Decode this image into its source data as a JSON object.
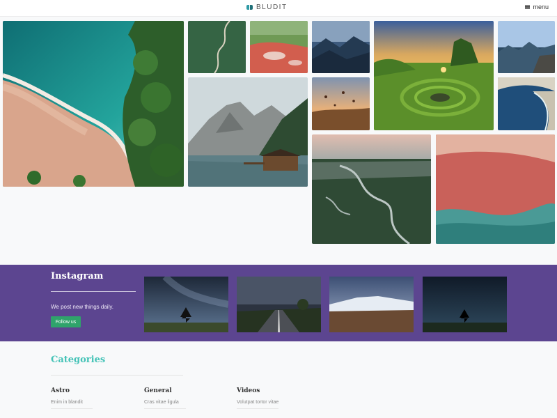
{
  "header": {
    "brand": "BLUDIT",
    "brand_icon": "bludit-logo-icon",
    "menu_label": "menu",
    "menu_icon": "hamburger-icon"
  },
  "gallery": {
    "photos": [
      "beach-aerial-photo",
      "winding-road-photo",
      "red-lake-photo",
      "misty-mountains-photo",
      "green-hill-sunset-photo",
      "mountain-cliff-photo",
      "hot-air-balloons-photo",
      "bay-aerial-photo",
      "lake-cabin-photo",
      "river-valley-photo",
      "pink-lagoon-aerial-photo"
    ]
  },
  "instagram": {
    "title": "Instagram",
    "description": "We post new things daily.",
    "button_label": "Follow us",
    "background_color": "#5c4590",
    "button_color": "#2fa36b",
    "photos": [
      "milky-way-tree-photo",
      "night-road-photo",
      "snowy-mountain-dusk-photo",
      "starry-night-tree-photo"
    ]
  },
  "categories": {
    "heading": "Categories",
    "heading_color": "#45c3b7",
    "items": [
      {
        "name": "Astro",
        "post": "Enim in blandit"
      },
      {
        "name": "General",
        "post": "Cras vitae ligula"
      },
      {
        "name": "Videos",
        "post": "Volutpat tortor vitae"
      }
    ]
  }
}
